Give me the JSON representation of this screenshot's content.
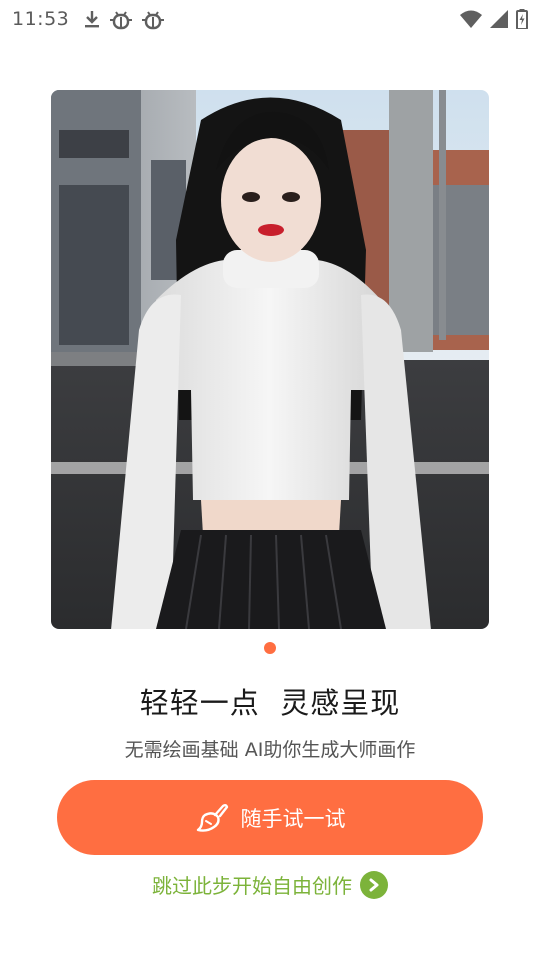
{
  "status_bar": {
    "time": "11:53",
    "left_icons": [
      "download-icon",
      "debug-bug-icon",
      "debug-bug-icon"
    ],
    "right_icons": [
      "wifi-icon",
      "cellular-signal-icon",
      "battery-charging-icon"
    ]
  },
  "hero": {
    "image_alt": "portrait"
  },
  "pager": {
    "count": 1,
    "active_index": 0
  },
  "onboarding": {
    "headline": "轻轻一点  灵感呈现",
    "subline": "无需绘画基础 AI助你生成大师画作",
    "primary_button_label": "随手试一试",
    "skip_label": "跳过此步开始自由创作"
  },
  "colors": {
    "accent": "#ff6e41",
    "skip_green": "#7cb33a",
    "headline": "#1a1a1a",
    "subline": "#555555"
  }
}
